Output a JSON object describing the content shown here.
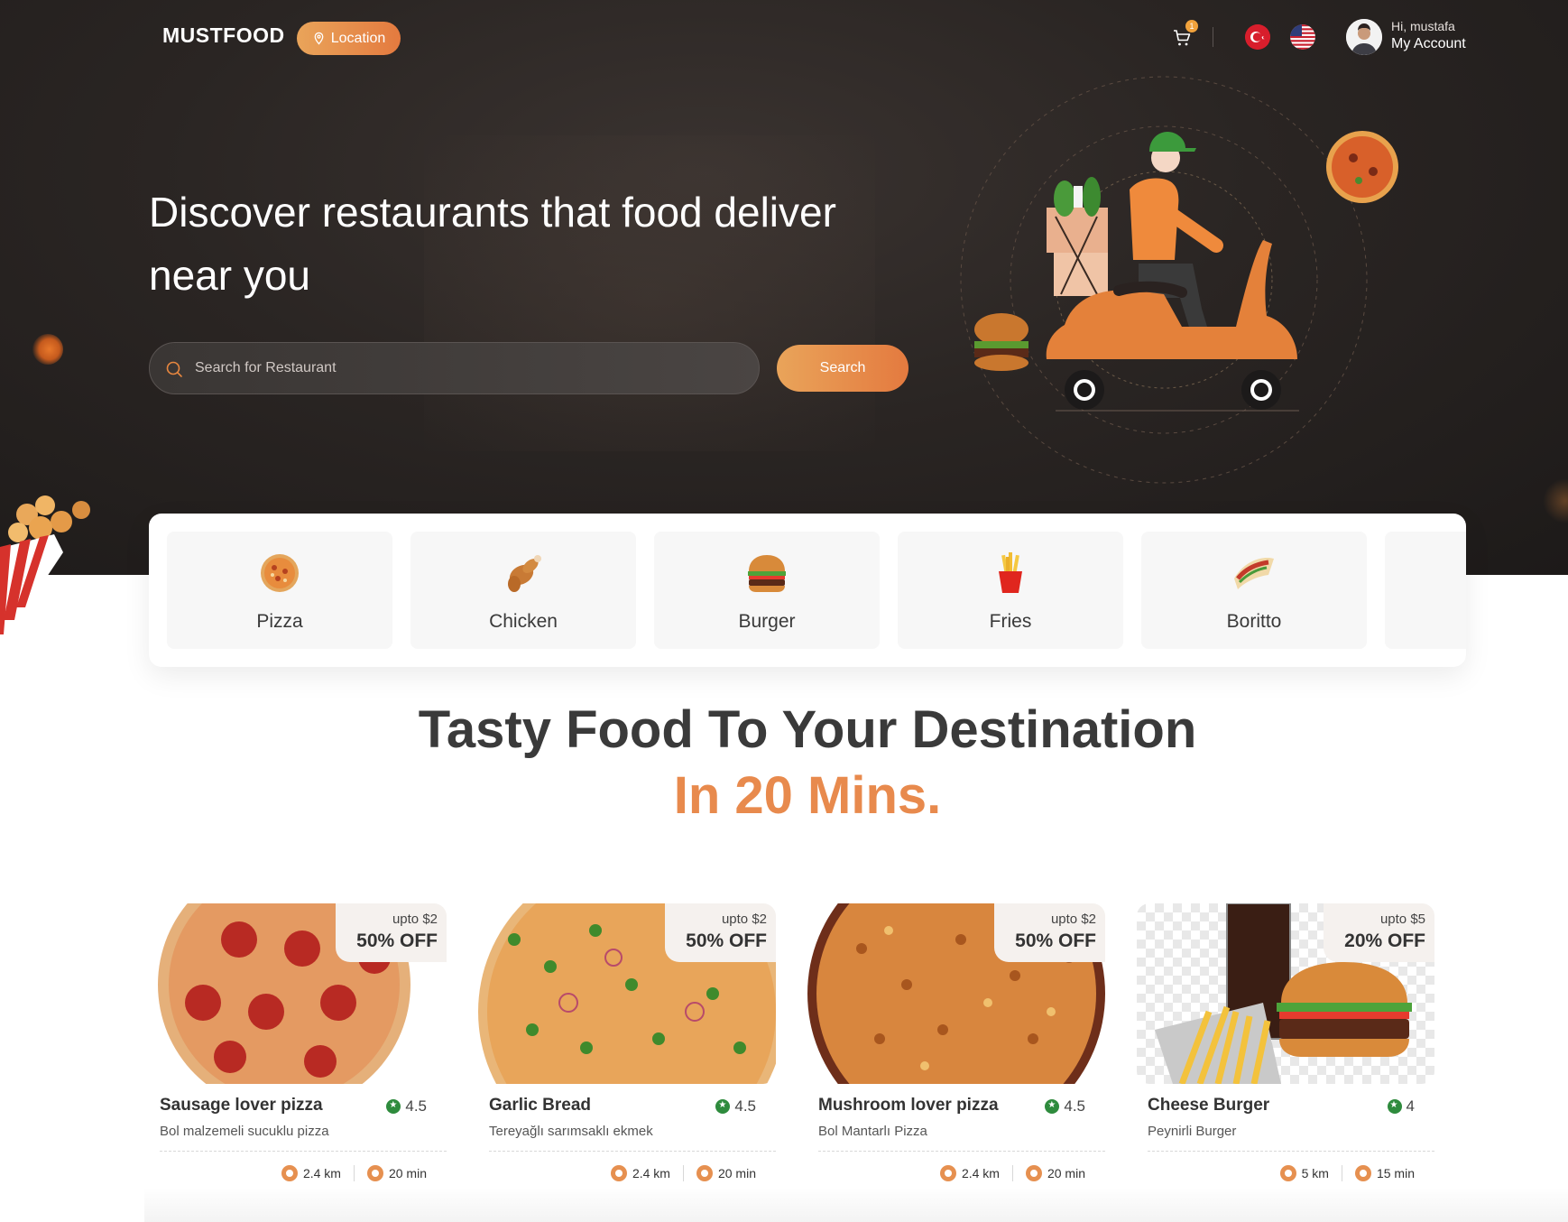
{
  "header": {
    "logo": "MUSTFOOD",
    "location_label": "Location",
    "cart_count": "1",
    "greeting": "Hi, mustafa",
    "account_label": "My Account",
    "languages": [
      "tr-flag-icon",
      "us-flag-icon"
    ]
  },
  "hero": {
    "title": "Discover restaurants that food deliver near you",
    "search_placeholder": "Search for Restaurant",
    "search_button": "Search"
  },
  "categories": [
    {
      "label": "Pizza",
      "icon": "pizza-icon"
    },
    {
      "label": "Chicken",
      "icon": "chicken-icon"
    },
    {
      "label": "Burger",
      "icon": "burger-icon"
    },
    {
      "label": "Fries",
      "icon": "fries-icon"
    },
    {
      "label": "Boritto",
      "icon": "burrito-icon"
    }
  ],
  "headline": {
    "line1": "Tasty Food To Your Destination",
    "line2": "In 20 Mins."
  },
  "restaurants": [
    {
      "name": "Sausage lover pizza",
      "desc": "Bol malzemeli sucuklu pizza",
      "rating": "4.5",
      "upto": "upto $2",
      "off": "50% OFF",
      "distance": "2.4 km",
      "time": "20 min"
    },
    {
      "name": "Garlic Bread",
      "desc": "Tereyağlı sarımsaklı ekmek",
      "rating": "4.5",
      "upto": "upto $2",
      "off": "50% OFF",
      "distance": "2.4 km",
      "time": "20 min"
    },
    {
      "name": "Mushroom lover pizza",
      "desc": "Bol Mantarlı Pizza",
      "rating": "4.5",
      "upto": "upto $2",
      "off": "50% OFF",
      "distance": "2.4 km",
      "time": "20 min"
    },
    {
      "name": "Cheese Burger",
      "desc": "Peynirli Burger",
      "rating": "4",
      "upto": "upto $5",
      "off": "20% OFF",
      "distance": "5 km",
      "time": "15 min"
    }
  ],
  "colors": {
    "accent": "#e8873f",
    "accent_light": "#e9a45a",
    "hero_bg": "#2a2523",
    "rating_green": "#2e8b3d"
  }
}
